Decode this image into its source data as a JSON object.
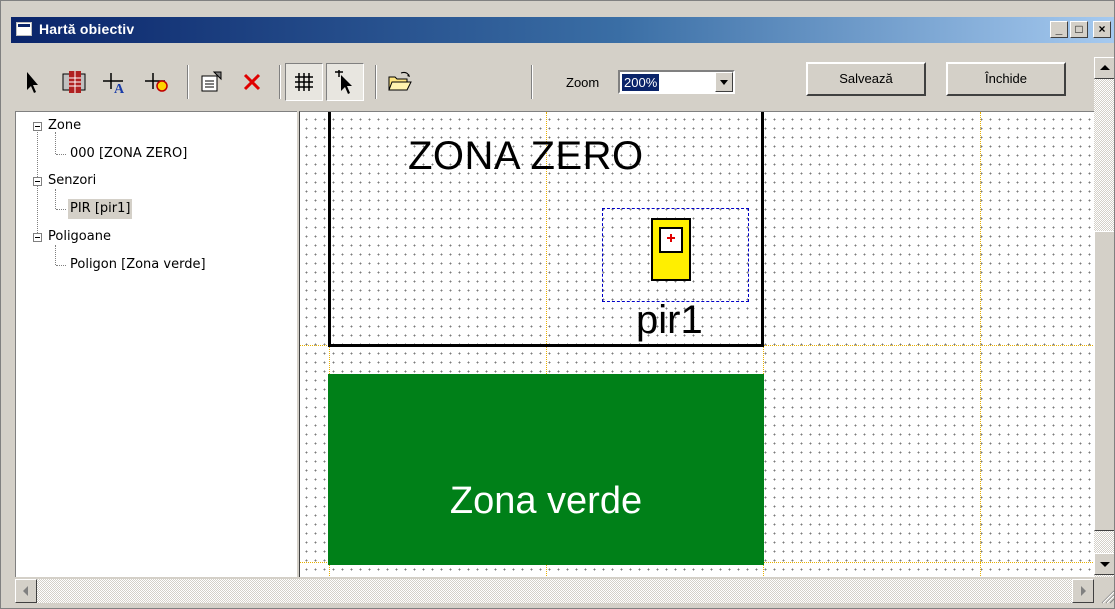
{
  "window": {
    "title": "Hartă obiectiv",
    "controls": {
      "minimize": "_",
      "maximize": "□",
      "close": "×"
    }
  },
  "toolbar": {
    "tools": [
      {
        "name": "select-arrow-icon"
      },
      {
        "name": "zone-draw-icon"
      },
      {
        "name": "add-text-icon"
      },
      {
        "name": "add-sensor-icon"
      },
      {
        "name": "properties-icon"
      },
      {
        "name": "delete-icon"
      },
      {
        "name": "grid-toggle-icon",
        "pressed": true
      },
      {
        "name": "snap-cursor-icon",
        "pressed": true
      },
      {
        "name": "open-folder-icon"
      }
    ],
    "zoom_label": "Zoom",
    "zoom_value": "200%",
    "save_label": "Salvează",
    "close_label": "Închide"
  },
  "tree": {
    "groups": [
      {
        "label": "Zone",
        "children": [
          "000 [ZONA ZERO]"
        ]
      },
      {
        "label": "Senzori",
        "children": [
          "PIR [pir1]"
        ]
      },
      {
        "label": "Poligoane",
        "children": [
          "Poligon [Zona verde]"
        ]
      }
    ],
    "selected": "PIR [pir1]"
  },
  "canvas": {
    "zone_label": "ZONA ZERO",
    "sensor_label": "pir1",
    "polygon_label": "Zona verde",
    "colors": {
      "polygon": "#008018",
      "sensor": "#ffef00",
      "grid_major": "#e8b000",
      "selection": "#0000c8"
    }
  },
  "scrollbars": {
    "up": "▲",
    "down": "▼",
    "left": "◄",
    "right": "►"
  }
}
